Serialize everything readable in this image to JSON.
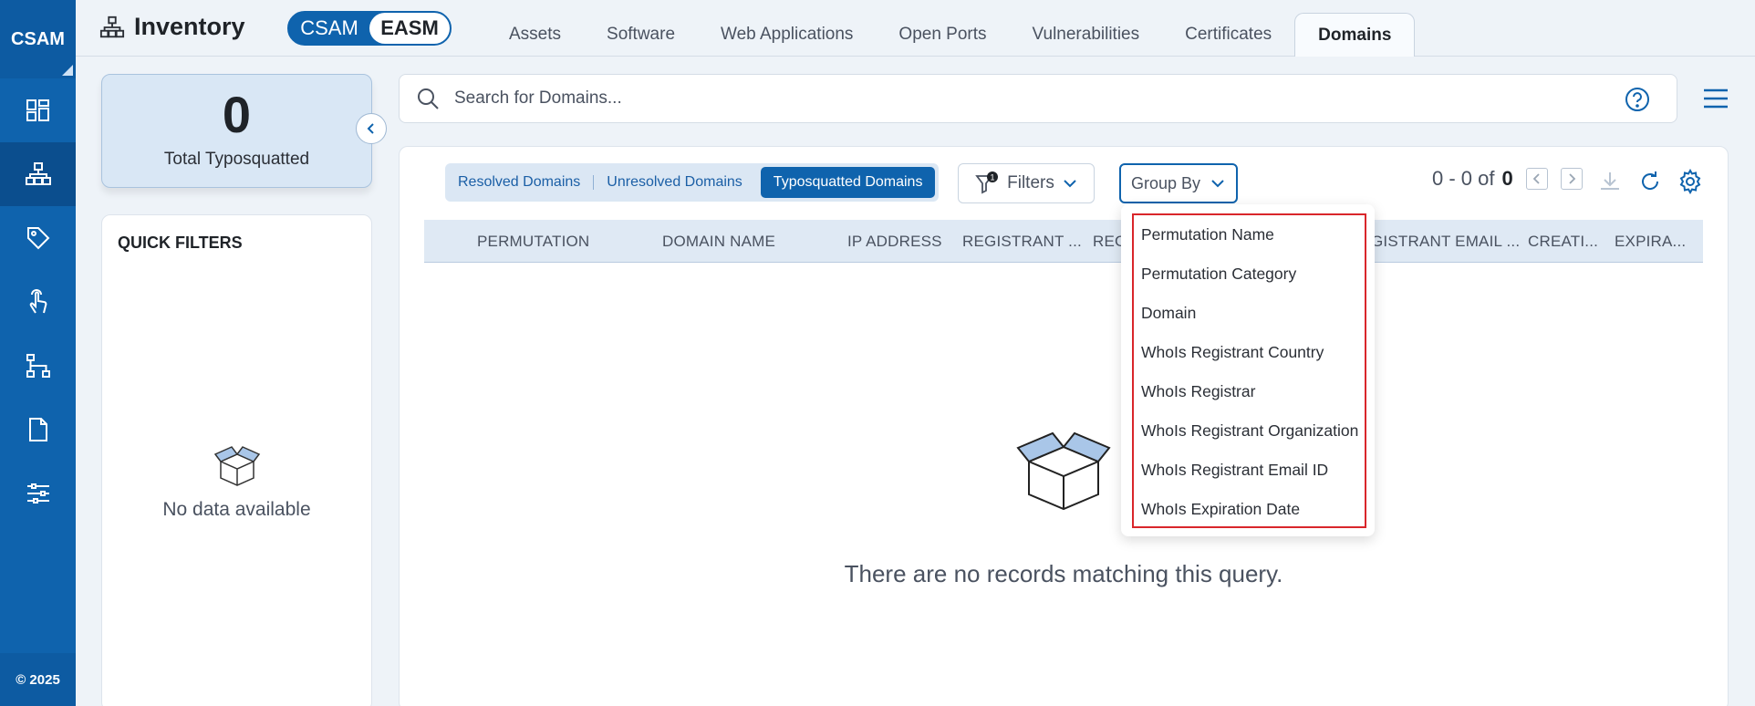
{
  "rail": {
    "logo": "CSAM",
    "items": [
      {
        "name": "dashboard-icon",
        "active": false
      },
      {
        "name": "inventory-icon",
        "active": true
      },
      {
        "name": "tag-icon",
        "active": false
      },
      {
        "name": "touch-icon",
        "active": false
      },
      {
        "name": "hierarchy-icon",
        "active": false
      },
      {
        "name": "document-icon",
        "active": false
      },
      {
        "name": "sliders-icon",
        "active": false
      }
    ],
    "footer": "© 2025"
  },
  "header": {
    "title": "Inventory",
    "toggle": {
      "left": "CSAM",
      "right": "EASM",
      "selected": "EASM"
    },
    "tabs": [
      {
        "label": "Assets",
        "active": false
      },
      {
        "label": "Software",
        "active": false
      },
      {
        "label": "Web Applications",
        "active": false
      },
      {
        "label": "Open Ports",
        "active": false
      },
      {
        "label": "Vulnerabilities",
        "active": false
      },
      {
        "label": "Certificates",
        "active": false
      },
      {
        "label": "Domains",
        "active": true
      }
    ]
  },
  "stat": {
    "value": "0",
    "label": "Total Typosquatted"
  },
  "quick_filters": {
    "title": "QUICK FILTERS",
    "empty": "No data available"
  },
  "search": {
    "placeholder": "Search for Domains...",
    "value": ""
  },
  "segments": {
    "items": [
      "Resolved Domains",
      "Unresolved Domains",
      "Typosquatted Domains"
    ],
    "selected": "Typosquatted Domains"
  },
  "filters": {
    "label": "Filters",
    "badge": "1"
  },
  "group_by": {
    "label": "Group By",
    "options": [
      "Permutation Name",
      "Permutation Category",
      "Domain",
      "WhoIs Registrant Country",
      "WhoIs Registrar",
      "WhoIs Registrant Organization",
      "WhoIs Registrant Email ID",
      "WhoIs Expiration Date"
    ]
  },
  "pager": {
    "range": "0 - 0 of",
    "total": "0"
  },
  "table": {
    "columns": [
      "PERMUTATION",
      "DOMAIN NAME",
      "IP ADDRESS",
      "REGISTRANT ...",
      "REG",
      "GISTRANT EMAIL ...",
      "CREATI...",
      "EXPIRA..."
    ],
    "empty": "There are no records matching this query."
  },
  "colors": {
    "brand": "#0f63ad",
    "highlight": "#d9262b"
  }
}
